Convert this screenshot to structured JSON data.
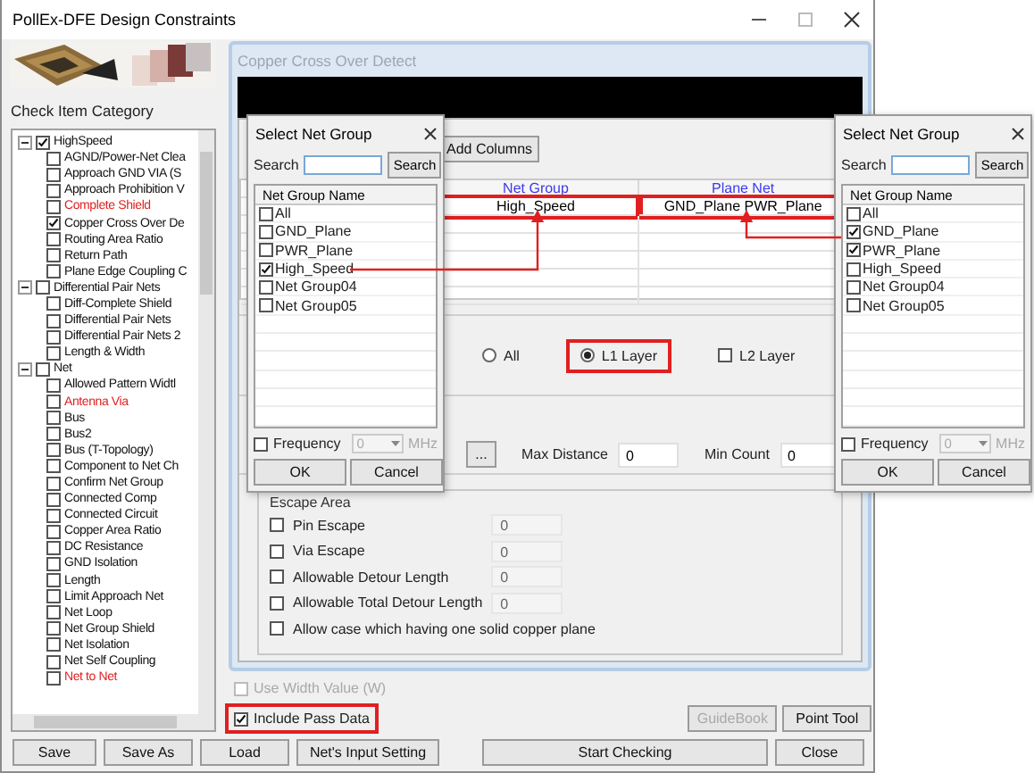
{
  "window": {
    "title": "PollEx-DFE Design Constraints"
  },
  "category": {
    "heading": "Check Item Category",
    "tree": [
      {
        "label": "HighSpeed",
        "checked": true,
        "expanded": true,
        "flagged": false,
        "children": [
          {
            "label": "AGND/Power-Net Clea",
            "checked": false,
            "flagged": false
          },
          {
            "label": "Approach GND VIA (S",
            "checked": false,
            "flagged": false
          },
          {
            "label": "Approach Prohibition V",
            "checked": false,
            "flagged": false
          },
          {
            "label": "Complete Shield",
            "checked": false,
            "flagged": true
          },
          {
            "label": "Copper Cross Over De",
            "checked": true,
            "flagged": false
          },
          {
            "label": "Routing Area Ratio",
            "checked": false,
            "flagged": false
          },
          {
            "label": "Return Path",
            "checked": false,
            "flagged": false
          },
          {
            "label": "Plane Edge Coupling C",
            "checked": false,
            "flagged": false
          }
        ]
      },
      {
        "label": "Differential Pair Nets",
        "checked": false,
        "expanded": true,
        "flagged": false,
        "children": [
          {
            "label": "Diff-Complete Shield",
            "checked": false,
            "flagged": false
          },
          {
            "label": "Differential Pair Nets",
            "checked": false,
            "flagged": false
          },
          {
            "label": "Differential Pair Nets 2",
            "checked": false,
            "flagged": false
          },
          {
            "label": "Length & Width",
            "checked": false,
            "flagged": false
          }
        ]
      },
      {
        "label": "Net",
        "checked": false,
        "expanded": true,
        "flagged": false,
        "children": [
          {
            "label": "Allowed Pattern Widtl",
            "checked": false,
            "flagged": false
          },
          {
            "label": "Antenna Via",
            "checked": false,
            "flagged": true
          },
          {
            "label": "Bus",
            "checked": false,
            "flagged": false
          },
          {
            "label": "Bus2",
            "checked": false,
            "flagged": false
          },
          {
            "label": "Bus (T-Topology)",
            "checked": false,
            "flagged": false
          },
          {
            "label": "Component to Net Ch",
            "checked": false,
            "flagged": false
          },
          {
            "label": "Confirm Net Group",
            "checked": false,
            "flagged": false
          },
          {
            "label": "Connected Comp",
            "checked": false,
            "flagged": false
          },
          {
            "label": "Connected Circuit",
            "checked": false,
            "flagged": false
          },
          {
            "label": "Copper Area Ratio",
            "checked": false,
            "flagged": false
          },
          {
            "label": "DC Resistance",
            "checked": false,
            "flagged": false
          },
          {
            "label": "GND Isolation",
            "checked": false,
            "flagged": false
          },
          {
            "label": "Length",
            "checked": false,
            "flagged": false
          },
          {
            "label": "Limit Approach Net",
            "checked": false,
            "flagged": false
          },
          {
            "label": "Net Loop",
            "checked": false,
            "flagged": false
          },
          {
            "label": "Net Group Shield",
            "checked": false,
            "flagged": false
          },
          {
            "label": "Net Isolation",
            "checked": false,
            "flagged": false
          },
          {
            "label": "Net Self Coupling",
            "checked": false,
            "flagged": false
          },
          {
            "label": "Net to Net",
            "checked": false,
            "flagged": true
          }
        ]
      }
    ]
  },
  "panel": {
    "title": "Copper Cross Over Detect",
    "add_columns_button": "Add Columns",
    "table": {
      "columns": [
        "Net Group",
        "Plane Net"
      ],
      "rows": [
        [
          {
            "text": "High_Speed",
            "highlighted": true
          },
          {
            "text": "GND_Plane PWR_Plane",
            "highlighted": true
          }
        ]
      ]
    },
    "layer_options": [
      {
        "kind": "radio",
        "label": "All",
        "selected": false,
        "highlighted": false
      },
      {
        "kind": "radio",
        "label": "L1 Layer",
        "selected": true,
        "highlighted": true
      },
      {
        "kind": "checkbox",
        "label": "L2 Layer",
        "checked": false,
        "highlighted": false
      }
    ],
    "browse_button": "...",
    "max_distance": {
      "label": "Max Distance",
      "value": "0"
    },
    "min_count": {
      "label": "Min Count",
      "value": "0"
    },
    "escape_area": {
      "title": "Escape Area",
      "options": [
        {
          "label": "Pin Escape",
          "checked": false,
          "value": "0"
        },
        {
          "label": "Via Escape",
          "checked": false,
          "value": "0"
        },
        {
          "label": "Allowable Detour Length",
          "checked": false,
          "value": "0"
        },
        {
          "label": "Allowable Total Detour Length",
          "checked": false,
          "value": "0"
        },
        {
          "label": "Allow case which having one solid copper plane",
          "checked": false
        }
      ]
    }
  },
  "use_width_value": {
    "label": "Use Width Value (W)",
    "checked": false,
    "disabled": true
  },
  "include_pass_data": {
    "label": "Include Pass Data",
    "checked": true,
    "highlighted": true
  },
  "guidebook_button": {
    "label": "GuideBook",
    "disabled": true
  },
  "point_tool_button": {
    "label": "Point Tool",
    "disabled": false
  },
  "bottom_buttons": [
    "Save",
    "Save As",
    "Load",
    "Net's Input Setting",
    "Start Checking",
    "Close"
  ],
  "dialogs": [
    {
      "title": "Select Net Group",
      "search_label": "Search",
      "search_button": "Search",
      "column": "Net Group Name",
      "items": [
        {
          "label": "All",
          "checked": false
        },
        {
          "label": "GND_Plane",
          "checked": false
        },
        {
          "label": "PWR_Plane",
          "checked": false
        },
        {
          "label": "High_Speed",
          "checked": true
        },
        {
          "label": "Net Group04",
          "checked": false
        },
        {
          "label": "Net Group05",
          "checked": false
        }
      ],
      "frequency": {
        "label": "Frequency",
        "checked": false,
        "value": "0",
        "unit": "MHz"
      },
      "buttons": [
        "OK",
        "Cancel"
      ]
    },
    {
      "title": "Select Net Group",
      "search_label": "Search",
      "search_button": "Search",
      "column": "Net Group Name",
      "items": [
        {
          "label": "All",
          "checked": false
        },
        {
          "label": "GND_Plane",
          "checked": true
        },
        {
          "label": "PWR_Plane",
          "checked": true
        },
        {
          "label": "High_Speed",
          "checked": false
        },
        {
          "label": "Net Group04",
          "checked": false
        },
        {
          "label": "Net Group05",
          "checked": false
        }
      ],
      "frequency": {
        "label": "Frequency",
        "checked": false,
        "value": "0",
        "unit": "MHz"
      },
      "buttons": [
        "OK",
        "Cancel"
      ]
    }
  ]
}
